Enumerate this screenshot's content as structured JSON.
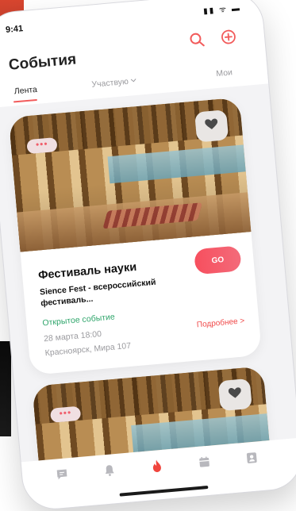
{
  "status": {
    "time": "9:41",
    "icons": "▮▮ ᯤ ▬"
  },
  "header": {
    "title": "События"
  },
  "tabs": [
    {
      "label": "Лента",
      "active": true
    },
    {
      "label": "Участвую",
      "has_chevron": true
    },
    {
      "label": "Мои"
    }
  ],
  "events": [
    {
      "title": "Фестиваль науки",
      "description": "Sience Fest - всероссийский фестиваль...",
      "visibility": "Открытое событие",
      "date": "28 марта 18:00",
      "address": "Красноярск, Мира 107",
      "go_label": "GO",
      "more_label": "Подробнее >",
      "dots": "•••"
    },
    {
      "dots": "•••"
    }
  ],
  "tabbar": {
    "items": [
      "chat-icon",
      "bell-icon",
      "flame-icon",
      "calendar-icon",
      "profile-icon"
    ]
  },
  "colors": {
    "accent": "#f25b5b",
    "green": "#2fa56b",
    "muted": "#9b9b9f"
  }
}
